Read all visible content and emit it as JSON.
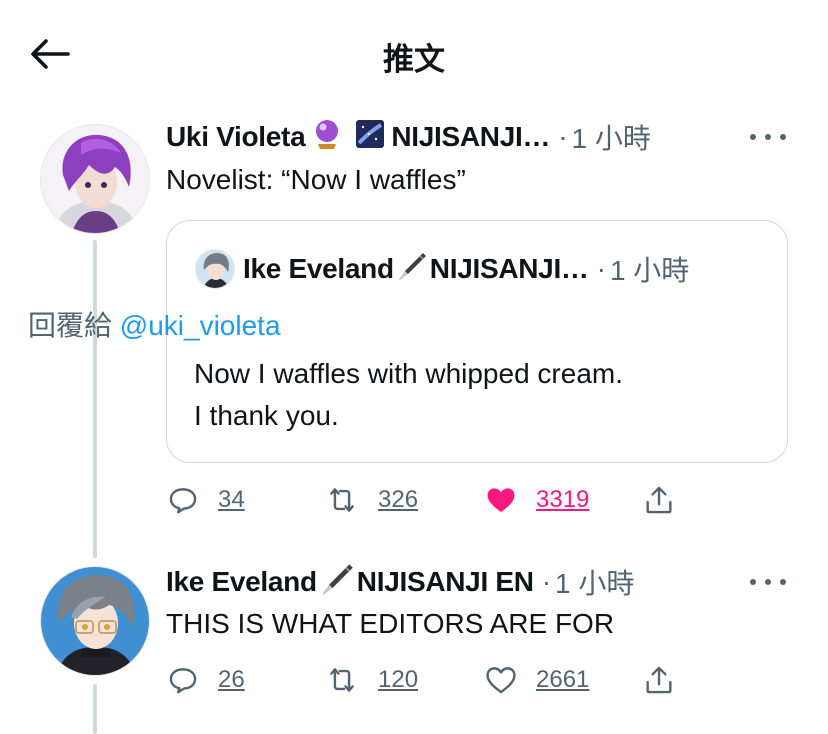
{
  "header": {
    "title": "推文"
  },
  "tweet1": {
    "display_name": "Uki Violeta",
    "name_suffix": "NIJISANJI…",
    "time": "1 小時",
    "text": "Novelist: “Now I waffles”",
    "quote": {
      "display_name": "Ike Eveland",
      "name_suffix": "NIJISANJI…",
      "time": "1 小時",
      "reply_prefix": "回覆給",
      "reply_to": "@uki_violeta",
      "line1": "Now I waffles with whipped cream.",
      "line2": "I thank you."
    },
    "stats": {
      "replies": "34",
      "retweets": "326",
      "likes": "3319"
    },
    "liked": true
  },
  "tweet2": {
    "display_name": "Ike Eveland",
    "name_suffix": "NIJISANJI EN",
    "time": "1 小時",
    "text": "THIS IS WHAT EDITORS ARE FOR",
    "stats": {
      "replies": "26",
      "retweets": "120",
      "likes": "2661"
    },
    "liked": false
  },
  "colors": {
    "accent_blue": "#1d9bf0",
    "like_pink": "#f91880",
    "secondary_text": "#536471",
    "thread_line": "#cfd9de"
  },
  "icons": [
    "back-arrow-icon",
    "crystal-ball-emoji",
    "night-sky-emoji",
    "fountain-pen-emoji",
    "more-icon",
    "reply-icon",
    "retweet-icon",
    "heart-icon",
    "share-icon"
  ]
}
